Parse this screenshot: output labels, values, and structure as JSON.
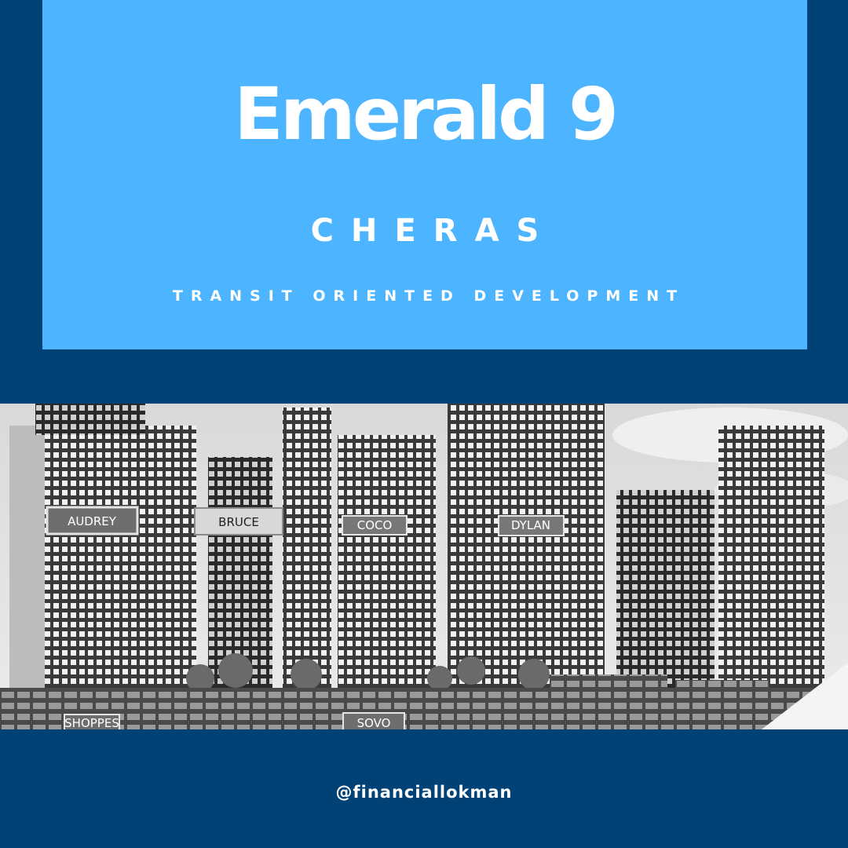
{
  "header": {
    "title": "Emerald 9",
    "subtitle": "CHERAS",
    "tagline": "TRANSIT ORIENTED DEVELOPMENT"
  },
  "rendering": {
    "labels": {
      "audrey": "AUDREY",
      "bruce": "BRUCE",
      "coco": "COCO",
      "dylan": "DYLAN",
      "shoppes": "SHOPPES",
      "sovo": "SOVO"
    }
  },
  "footer": {
    "handle": "@financiallokman"
  },
  "colors": {
    "background": "#004275",
    "hero": "#4db4ff",
    "text": "#ffffff"
  }
}
